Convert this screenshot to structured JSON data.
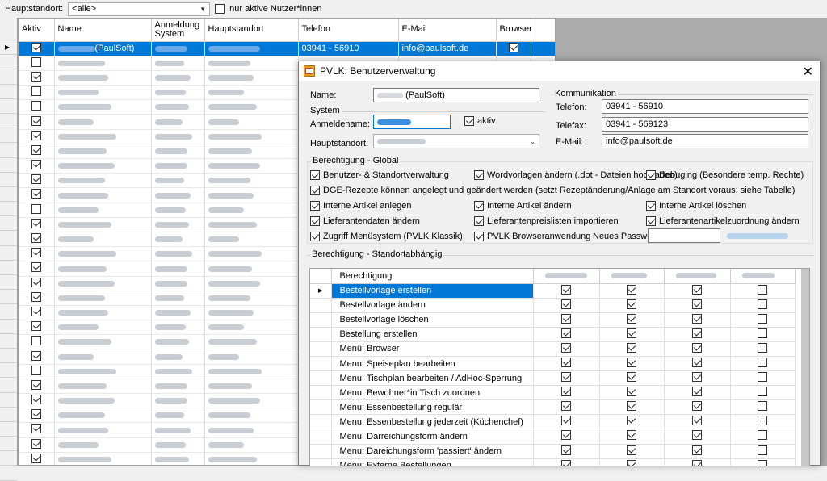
{
  "filter": {
    "label": "Hauptstandort:",
    "value": "<alle>",
    "inactive_label": "nur aktive Nutzer*innen",
    "inactive_checked": false
  },
  "grid": {
    "columns": [
      "Aktiv",
      "Name",
      "Anmeldung System",
      "Hauptstandort",
      "Telefon",
      "E-Mail",
      "Browser"
    ],
    "rows": [
      {
        "aktiv": true,
        "name": "(PaulSoft)",
        "telefon": "03941 - 56910",
        "email": "info@paulsoft.de",
        "browser": true,
        "selected": true
      },
      {
        "aktiv": false
      },
      {
        "aktiv": true
      },
      {
        "aktiv": false
      },
      {
        "aktiv": false
      },
      {
        "aktiv": true
      },
      {
        "aktiv": true
      },
      {
        "aktiv": true
      },
      {
        "aktiv": true
      },
      {
        "aktiv": true
      },
      {
        "aktiv": true
      },
      {
        "aktiv": false
      },
      {
        "aktiv": true
      },
      {
        "aktiv": true
      },
      {
        "aktiv": true
      },
      {
        "aktiv": true
      },
      {
        "aktiv": true
      },
      {
        "aktiv": true
      },
      {
        "aktiv": true
      },
      {
        "aktiv": true
      },
      {
        "aktiv": false
      },
      {
        "aktiv": true
      },
      {
        "aktiv": false
      },
      {
        "aktiv": true
      },
      {
        "aktiv": true
      },
      {
        "aktiv": true
      },
      {
        "aktiv": true
      },
      {
        "aktiv": true
      },
      {
        "aktiv": true
      },
      {
        "aktiv": true
      }
    ]
  },
  "dialog": {
    "title": "PVLK: Benutzerverwaltung",
    "name_label": "Name:",
    "name_value": "(PaulSoft)",
    "system_group": "System",
    "anmeldename_label": "Anmeldename:",
    "aktiv_label": "aktiv",
    "aktiv_checked": true,
    "hauptstandort_label": "Hauptstandort:",
    "komm_group": "Kommunikation",
    "telefon_label": "Telefon:",
    "telefon_value": "03941 - 56910",
    "telefax_label": "Telefax:",
    "telefax_value": "03941 - 569123",
    "email_label": "E-Mail:",
    "email_value": "info@paulsoft.de",
    "global_group": "Berechtigung - Global",
    "global_perms": [
      {
        "label": "Benutzer- & Standortverwaltung",
        "checked": true
      },
      {
        "label": "Wordvorlagen ändern (.dot - Dateien hochladen)",
        "checked": true
      },
      {
        "label": "Debuging (Besondere temp. Rechte)",
        "checked": true
      },
      {
        "label": "DGE-Rezepte können angelegt und geändert werden (setzt Rezeptänderung/Anlage am Standort voraus; siehe Tabelle)",
        "checked": true
      },
      {
        "label": "Interne Artikel anlegen",
        "checked": true
      },
      {
        "label": "Interne Artikel ändern",
        "checked": true
      },
      {
        "label": "Interne Artikel löschen",
        "checked": true
      },
      {
        "label": "Lieferantendaten ändern",
        "checked": true
      },
      {
        "label": "Lieferantenpreislisten importieren",
        "checked": true
      },
      {
        "label": "Lieferantenartikelzuordnung ändern",
        "checked": true
      },
      {
        "label": "Zugriff Menüsystem (PVLK Klassik)",
        "checked": true
      },
      {
        "label": "PVLK Browseranwendung",
        "checked": true
      }
    ],
    "passwort_label": "Neues Passwort:",
    "standort_group": "Berechtigung - Standortabhängig",
    "perm_header": "Berechtigung",
    "perm_rows": [
      {
        "label": "Bestellvorlage erstellen",
        "v": [
          true,
          true,
          true,
          false
        ]
      },
      {
        "label": "Bestellvorlage ändern",
        "v": [
          true,
          true,
          true,
          false
        ]
      },
      {
        "label": "Bestellvorlage löschen",
        "v": [
          true,
          true,
          true,
          false
        ]
      },
      {
        "label": "Bestellung erstellen",
        "v": [
          true,
          true,
          true,
          false
        ]
      },
      {
        "label": "Menü: Browser",
        "v": [
          true,
          true,
          true,
          false
        ]
      },
      {
        "label": "Menu: Speiseplan bearbeiten",
        "v": [
          true,
          true,
          true,
          false
        ]
      },
      {
        "label": "Menu: Tischplan bearbeiten / AdHoc-Sperrung",
        "v": [
          true,
          true,
          true,
          false
        ]
      },
      {
        "label": "Menu: Bewohner*in Tisch zuordnen",
        "v": [
          true,
          true,
          true,
          false
        ]
      },
      {
        "label": "Menu: Essenbestellung regulär",
        "v": [
          true,
          true,
          true,
          false
        ]
      },
      {
        "label": "Menu: Essenbestellung jederzeit (Küchenchef)",
        "v": [
          true,
          true,
          true,
          false
        ]
      },
      {
        "label": "Menu: Darreichungsform ändern",
        "v": [
          true,
          true,
          true,
          false
        ]
      },
      {
        "label": "Menu: Dareichungsform 'passiert' ändern",
        "v": [
          true,
          true,
          true,
          false
        ]
      },
      {
        "label": "Menu: Externe Bestellungen",
        "v": [
          true,
          true,
          true,
          false
        ]
      }
    ]
  }
}
